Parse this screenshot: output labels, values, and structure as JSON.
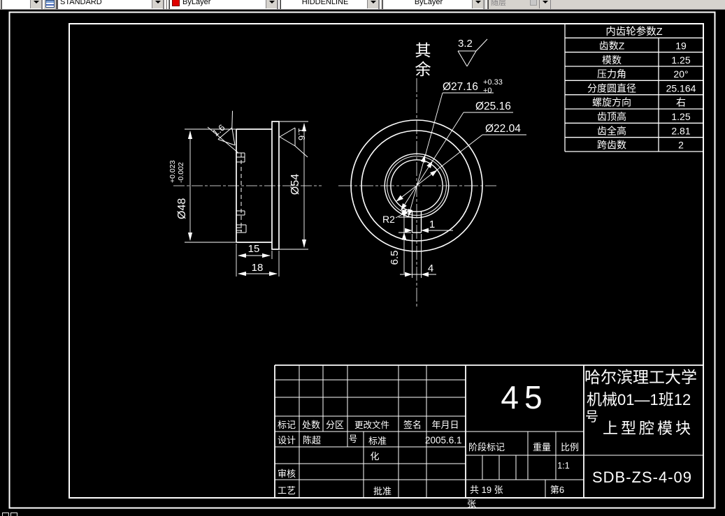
{
  "toolbar": {
    "style_combo": "STANDARD",
    "color_combo": "ByLayer",
    "linetype_combo": "HIDDENLINE",
    "lineweight_combo": "ByLayer",
    "plotstyle_combo": "随层"
  },
  "param_table": {
    "title": "内齿轮参数Z",
    "rows": [
      {
        "label": "齿数Z",
        "value": "19"
      },
      {
        "label": "模数",
        "value": "1.25"
      },
      {
        "label": "压力角",
        "value": "20°"
      },
      {
        "label": "分度圆直径",
        "value": "25.164"
      },
      {
        "label": "螺旋方向",
        "value": "右"
      },
      {
        "label": "齿顶高",
        "value": "1.25"
      },
      {
        "label": "齿全高",
        "value": "2.81"
      },
      {
        "label": "跨齿数",
        "value": "2"
      }
    ]
  },
  "annotations": {
    "surface_note_chars": [
      "其",
      "余"
    ],
    "surface_default_value": "3.2",
    "roughness_web": "1.6",
    "roughness_flange": "1.6",
    "dim_bore": "Ø27.16",
    "dim_bore_tol_upper": "+0.33",
    "dim_bore_tol_lower": "+0",
    "dim_pitch": "Ø25.16",
    "dim_root": "Ø22.04",
    "dim_shaft": "Ø48",
    "dim_shaft_tol_upper": "+0.023",
    "dim_shaft_tol_lower": "-0.002",
    "dim_flange": "Ø54",
    "dim_width_inner": "15",
    "dim_width_outer": "18",
    "dim_key_depth": "6.5",
    "dim_key_width": "4",
    "dim_key_offset": "1",
    "dim_key_radius": "R2"
  },
  "title_block": {
    "material": "45",
    "school_line1": "哈尔滨理工大学",
    "school_line2": "机械01—1班12",
    "school_line3": "号",
    "part_name": "上型腔模块",
    "drawing_no": "SDB-ZS-4-09",
    "col_mark": "标记",
    "col_count": "处数",
    "col_zone": "分区",
    "col_change_file_line1": "更改文件",
    "col_change_file_line2": "号",
    "col_sign": "签名",
    "col_date": "年月日",
    "row_design": "设计",
    "designer": "陈超",
    "design_date": "2005.6.1",
    "std_line1": "标准",
    "std_line2": "化",
    "row_check": "审核",
    "row_process": "工艺",
    "row_approve": "批准",
    "stage_mark": "阶段标记",
    "weight_label": "重量",
    "scale_label": "比例",
    "scale_value": "1:1",
    "sheets_total": "共 19 张",
    "sheet_no": "第6",
    "sheet_no_wrap": "张"
  }
}
